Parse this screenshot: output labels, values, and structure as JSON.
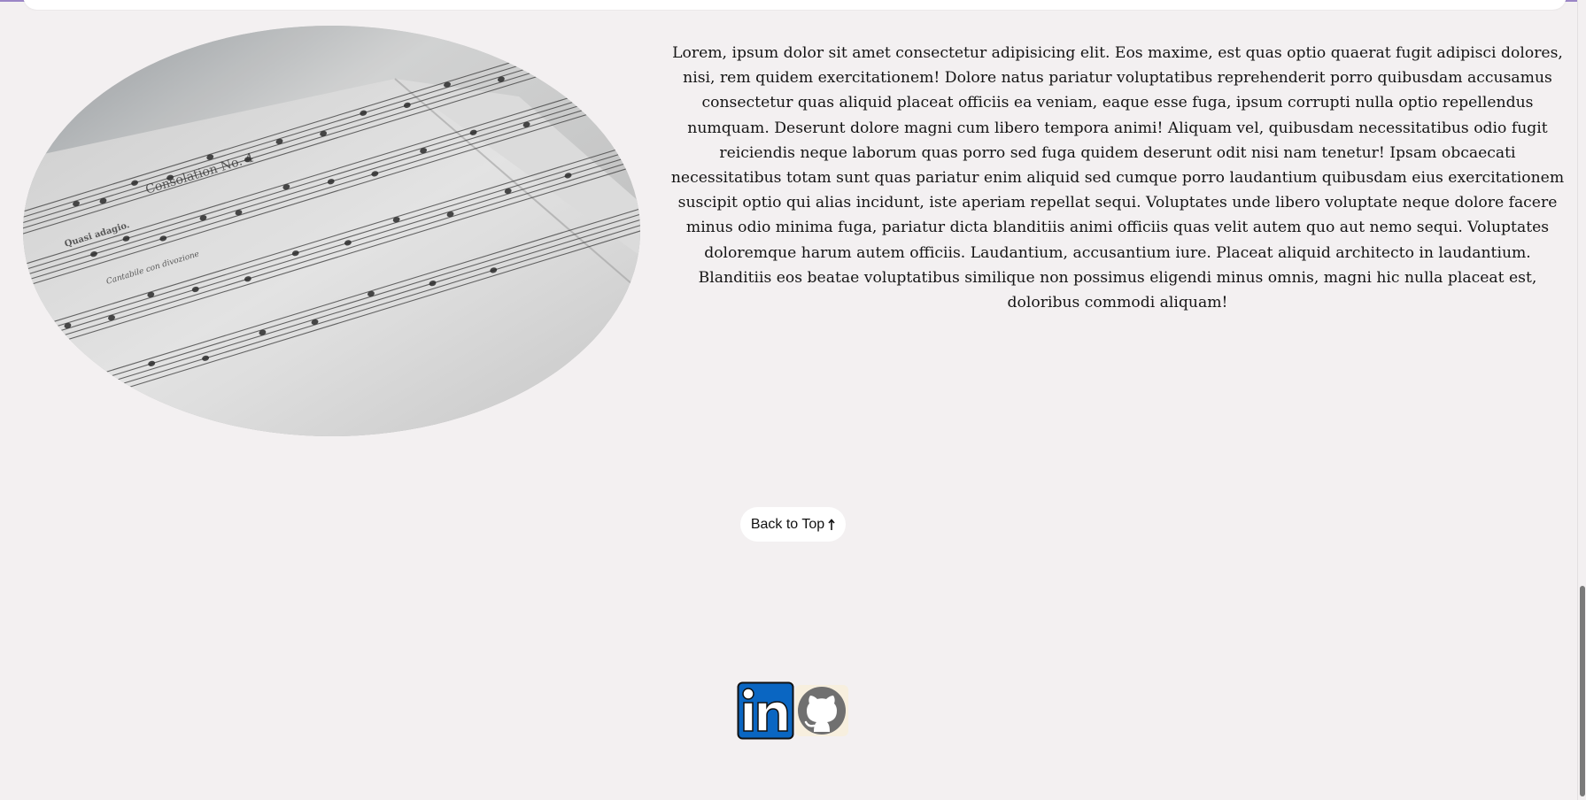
{
  "article": {
    "text": "Lorem, ipsum dolor sit amet consectetur adipisicing elit. Eos maxime, est quas optio quaerat fugit adipisci dolores, nisi, rem quidem exercitationem! Dolore natus pariatur voluptatibus reprehenderit porro quibusdam accusamus consectetur quas aliquid placeat officiis ea veniam, eaque esse fuga, ipsum corrupti nulla optio repellendus numquam. Deserunt dolore magni cum libero tempora animi! Aliquam vel, quibusdam necessitatibus odio fugit reiciendis neque laborum quas porro sed fuga quidem deserunt odit nisi nam tenetur! Ipsam obcaecati necessitatibus totam sunt quas pariatur enim aliquid sed cumque porro laudantium quibusdam eius exercitationem suscipit optio qui alias incidunt, iste aperiam repellat sequi. Voluptates unde libero voluptate neque dolore facere minus odio minima fuga, pariatur dicta blanditiis animi officiis quas velit autem quo aut nemo sequi. Voluptates doloremque harum autem officiis. Laudantium, accusantium iure. Placeat aliquid architecto in laudantium. Blanditiis eos beatae voluptatibus similique non possimus eligendi minus omnis, magni hic nulla placeat est, doloribus commodi aliquam!",
    "image_icon": "sheet-music-photo",
    "sheet_music": {
      "title": "Consolation No. 4",
      "tempo": "Quasi adagio.",
      "expression": "Cantabile con divozione"
    }
  },
  "back_to_top": {
    "label": "Back to Top",
    "icon": "arrow-up-icon"
  },
  "social_links": [
    {
      "name": "linkedin",
      "icon": "linkedin-icon",
      "color": "#0a66c2"
    },
    {
      "name": "github",
      "icon": "github-icon",
      "color": "#707070"
    }
  ],
  "colors": {
    "background": "#f3f0f1",
    "accent_line": "#9b86c6",
    "scrollbar_thumb": "#7a7a7a"
  }
}
